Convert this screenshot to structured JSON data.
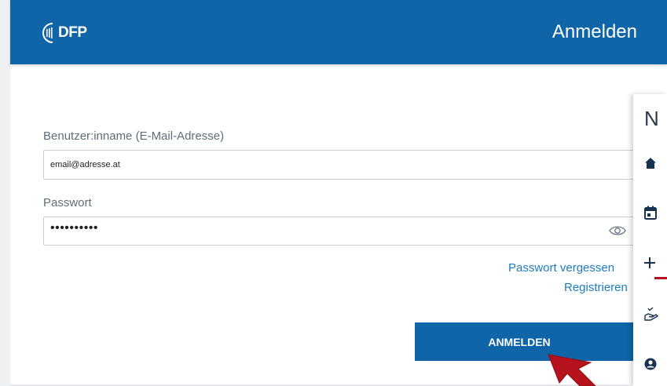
{
  "header": {
    "logo_text": "DFP",
    "title": "Anmelden"
  },
  "form": {
    "username_label": "Benutzer:inname (E-Mail-Adresse)",
    "username_value": "email@adresse.at",
    "password_label": "Passwort",
    "password_masked": "••••••••••",
    "forgot_link": "Passwort vergessen",
    "register_link": "Registrieren",
    "submit_label": "ANMELDEN"
  },
  "side_panel": {
    "title": "N",
    "icons": [
      "home-icon",
      "calendar-icon",
      "plus-icon",
      "hand-check-icon",
      "user-circle-icon"
    ]
  },
  "colors": {
    "brand": "#0f65a8",
    "link": "#1f7ac0",
    "accent_red": "#b5121b"
  }
}
